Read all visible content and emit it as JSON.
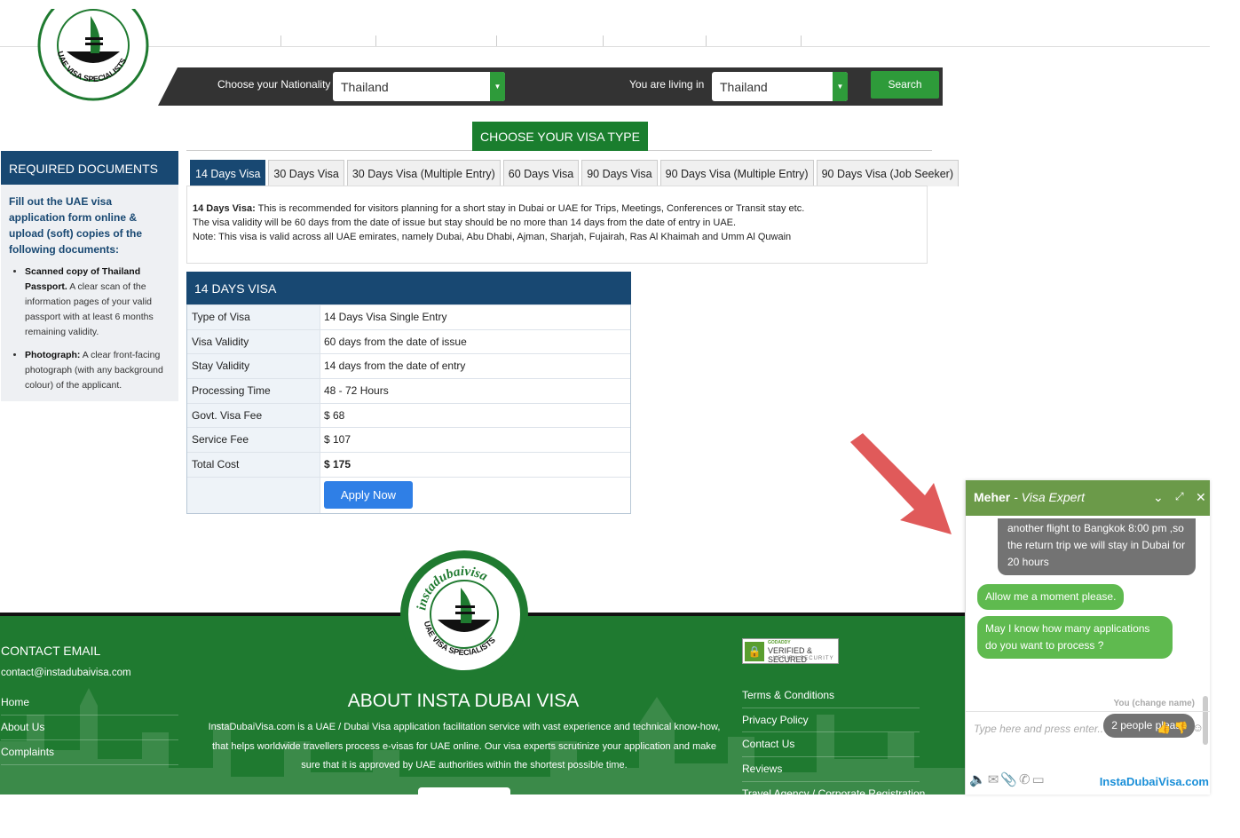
{
  "search": {
    "nationality_label": "Choose your Nationality",
    "nationality_value": "Thailand",
    "living_label": "You are living in",
    "living_value": "Thailand",
    "button_label": "Search"
  },
  "visa_type": {
    "heading": "CHOOSE YOUR VISA TYPE",
    "tabs": [
      {
        "label": "14 Days Visa",
        "active": true
      },
      {
        "label": "30 Days Visa"
      },
      {
        "label": "30 Days Visa (Multiple Entry)"
      },
      {
        "label": "60 Days Visa"
      },
      {
        "label": "90 Days Visa"
      },
      {
        "label": "90 Days Visa (Multiple Entry)"
      },
      {
        "label": "90 Days Visa (Job Seeker)"
      }
    ],
    "panel": {
      "title": "14 Days Visa:",
      "line1": " This is recommended for visitors planning for a short stay in Dubai or UAE for Trips, Meetings, Conferences or Transit stay etc.",
      "line2": "The visa validity will be 60 days from the date of issue but stay should be no more than 14 days from the date of entry in UAE.",
      "line3": "Note: This visa is valid across all UAE emirates, namely Dubai, Abu Dhabi, Ajman, Sharjah, Fujairah, Ras Al Khaimah and Umm Al Quwain"
    }
  },
  "sidebar": {
    "heading": "REQUIRED DOCUMENTS",
    "intro": "Fill out the UAE visa application form online & upload (soft) copies of the following documents:",
    "items": [
      {
        "bold": "Scanned copy of Thailand Passport.",
        "text": " A clear scan of the information pages of your valid passport with at least 6 months remaining validity."
      },
      {
        "bold": "Photograph:",
        "text": " A clear front-facing photograph (with any background colour) of the applicant."
      }
    ]
  },
  "visa_table": {
    "heading": "14 DAYS VISA",
    "rows": [
      {
        "key": "Type of Visa",
        "value": "14 Days Visa Single Entry"
      },
      {
        "key": "Visa Validity",
        "value": "60 days from the date of issue"
      },
      {
        "key": "Stay Validity",
        "value": "14 days from the date of entry"
      },
      {
        "key": "Processing Time",
        "value": "48 - 72 Hours"
      },
      {
        "key": "Govt. Visa Fee",
        "value": "$ 68"
      },
      {
        "key": "Service Fee",
        "value": "$ 107"
      },
      {
        "key": "Total Cost",
        "value": "$ 175"
      }
    ],
    "apply_label": "Apply Now"
  },
  "footer": {
    "contact_title": "CONTACT EMAIL",
    "contact_email": "contact@instadubaivisa.com",
    "links": [
      "Home",
      "About Us",
      "Complaints"
    ],
    "about_title": "ABOUT INSTA DUBAI VISA",
    "about_text": "InstaDubaiVisa.com is a UAE / Dubai Visa application facilitation service with vast experience and technical know-how, that helps worldwide travellers process e-visas for UAE online. Our visa experts scrutinize your application and make sure that it is approved by UAE authorities within the shortest possible time.",
    "right_links": [
      "Terms & Conditions",
      "Privacy Policy",
      "Contact Us",
      "Reviews",
      "Travel Agency / Corporate Registration"
    ],
    "badge": {
      "brand": "GODADDY",
      "line1": "VERIFIED & SECURED",
      "line2": "VERIFY SECURITY"
    }
  },
  "logo": {
    "top_text": "instadubaivisa",
    "bottom_text": "UAE VISA SPECIALISTS"
  },
  "chat": {
    "agent_name": "Meher",
    "agent_role": " - Visa Expert",
    "messages": [
      {
        "from": "agent-grey",
        "text": "another flight to Bangkok  8:00 pm ,so the return trip we will stay in Dubai for  20 hours"
      },
      {
        "from": "agent",
        "text": "Allow me a moment please."
      },
      {
        "from": "agent",
        "text": "May I know how many applications do you want to process ?"
      }
    ],
    "user_label": "You (change name)",
    "user_message": "2 people please",
    "input_placeholder": "Type here and press enter..",
    "brand": "InstaDubaiVisa.com"
  },
  "colors": {
    "navy": "#184872",
    "green": "#2e9b3a",
    "footer_green": "#1f7a30",
    "chat_green": "#6b9a49",
    "apply_blue": "#2f7fe6",
    "arrow_red": "#e05a5a"
  }
}
